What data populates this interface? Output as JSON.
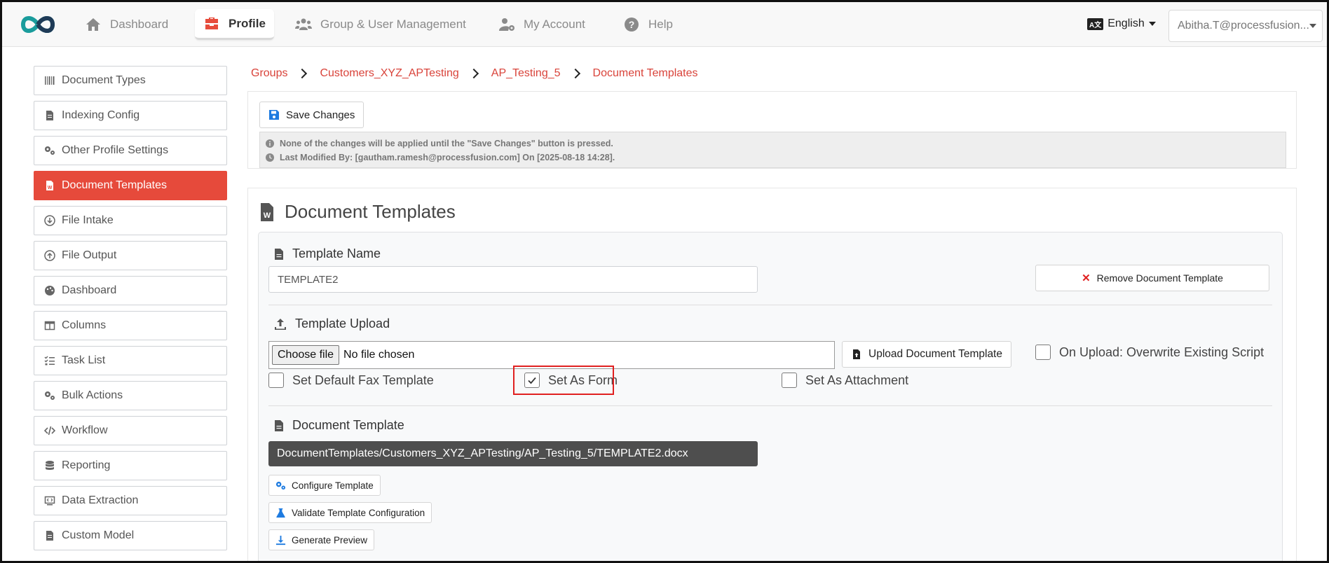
{
  "nav": {
    "items": [
      {
        "label": "Dashboard",
        "icon": "home-icon"
      },
      {
        "label": "Profile",
        "icon": "toolbox-icon",
        "active": true
      },
      {
        "label": "Group & User Management",
        "icon": "users-icon"
      },
      {
        "label": "My Account",
        "icon": "user-gear-icon"
      },
      {
        "label": "Help",
        "icon": "help-icon"
      }
    ],
    "language": "English",
    "language_badge": "A文",
    "user": "Abitha.T@processfusion..."
  },
  "sidebar": {
    "items": [
      {
        "label": "Document Types",
        "icon": "barcode-icon"
      },
      {
        "label": "Indexing Config",
        "icon": "file-icon"
      },
      {
        "label": "Other Profile Settings",
        "icon": "gears-icon"
      },
      {
        "label": "Document Templates",
        "icon": "word-file-icon",
        "active": true
      },
      {
        "label": "File Intake",
        "icon": "circle-down-icon"
      },
      {
        "label": "File Output",
        "icon": "circle-up-icon"
      },
      {
        "label": "Dashboard",
        "icon": "palette-icon"
      },
      {
        "label": "Columns",
        "icon": "columns-icon"
      },
      {
        "label": "Task List",
        "icon": "list-check-icon"
      },
      {
        "label": "Bulk Actions",
        "icon": "gears-icon"
      },
      {
        "label": "Workflow",
        "icon": "code-icon"
      },
      {
        "label": "Reporting",
        "icon": "database-icon"
      },
      {
        "label": "Data Extraction",
        "icon": "screen-code-icon"
      },
      {
        "label": "Custom Model",
        "icon": "file-lines-icon"
      }
    ]
  },
  "breadcrumb": [
    "Groups",
    "Customers_XYZ_APTesting",
    "AP_Testing_5",
    "Document Templates"
  ],
  "save": {
    "button": "Save Changes",
    "notice": "None of the changes will be applied until the \"Save Changes\" button is pressed.",
    "modified": "Last Modified By: [gautham.ramesh@processfusion.com] On [2025-08-18 14:28]."
  },
  "doc": {
    "title": "Document Templates",
    "template_name_label": "Template Name",
    "template_name_value": "TEMPLATE2",
    "remove_button": "Remove Document Template",
    "upload_label": "Template Upload",
    "choose_file": "Choose file",
    "no_file": "No file chosen",
    "upload_button": "Upload Document Template",
    "overwrite_label": "On Upload: Overwrite Existing Script",
    "set_default_fax": "Set Default Fax Template",
    "set_as_form": "Set As Form",
    "set_as_attachment": "Set As Attachment",
    "document_template_label": "Document Template",
    "document_template_path": "DocumentTemplates/Customers_XYZ_APTesting/AP_Testing_5/TEMPLATE2.docx",
    "configure_button": "Configure Template",
    "validate_button": "Validate Template Configuration",
    "preview_button": "Generate Preview"
  },
  "colors": {
    "accent": "#e64a3b",
    "link": "#d9433a",
    "icon_blue": "#1e7be0"
  }
}
